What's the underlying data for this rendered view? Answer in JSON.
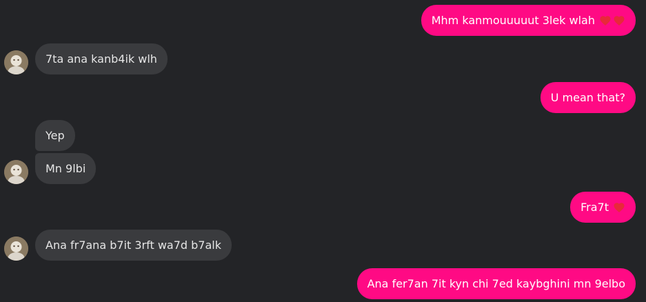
{
  "colors": {
    "background": "#232427",
    "outgoing_bubble": "#ff0a84",
    "incoming_bubble": "#3a3b3e",
    "heart": "#e8283a"
  },
  "messages": [
    {
      "direction": "outgoing",
      "text": "Mhm kanmouuuuut 3lek wlah",
      "emoji": [
        "red-heart",
        "red-heart"
      ]
    },
    {
      "direction": "incoming",
      "text": "7ta ana kanb4ik wlh",
      "avatar": true
    },
    {
      "direction": "outgoing",
      "text": "U mean that?"
    },
    {
      "direction": "incoming",
      "text": "Yep"
    },
    {
      "direction": "incoming",
      "text": "Mn 9lbi",
      "avatar": true
    },
    {
      "direction": "outgoing",
      "text": "Fra7t",
      "emoji": [
        "red-heart"
      ]
    },
    {
      "direction": "incoming",
      "text": "Ana fr7ana b7it 3rft wa7d b7alk",
      "avatar": true
    },
    {
      "direction": "outgoing",
      "text": "Ana fer7an 7it kyn chi 7ed kaybghini mn 9elbo"
    }
  ]
}
